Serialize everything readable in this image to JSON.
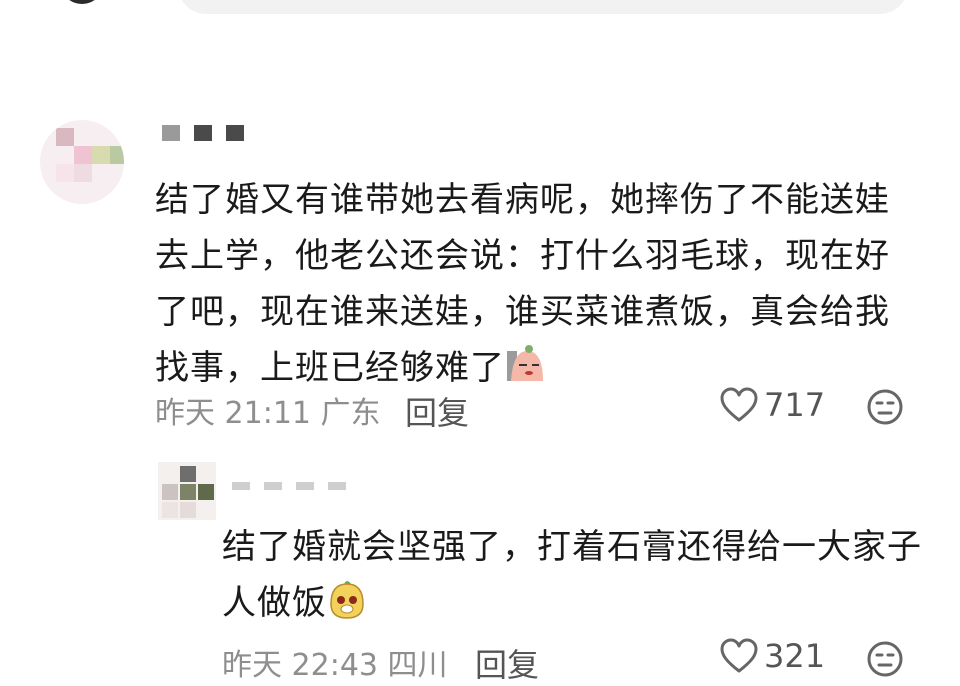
{
  "comment": {
    "text": "结了婚又有谁带她去看病呢，她摔伤了不能送娃去上学，他老公还会说：打什么羽毛球，现在好了吧，现在谁来送娃，谁买菜谁煮饭，真会给我找事，上班已经够难了",
    "timestamp": "昨天 21:11 广东",
    "reply_label": "回复",
    "likes": "717",
    "emoji": "tired-face-emoji"
  },
  "reply": {
    "text": "结了婚就会坚强了，打着石膏还得给一大家子人做饭",
    "timestamp": "昨天 22:43 四川",
    "reply_label": "回复",
    "likes": "321",
    "emoji": "crying-face-emoji"
  },
  "icons": {
    "like": "heart-outline-icon",
    "react": "neutral-face-icon"
  },
  "colors": {
    "meta_text": "#8e8e8e",
    "body_text": "#1a1a1a"
  }
}
